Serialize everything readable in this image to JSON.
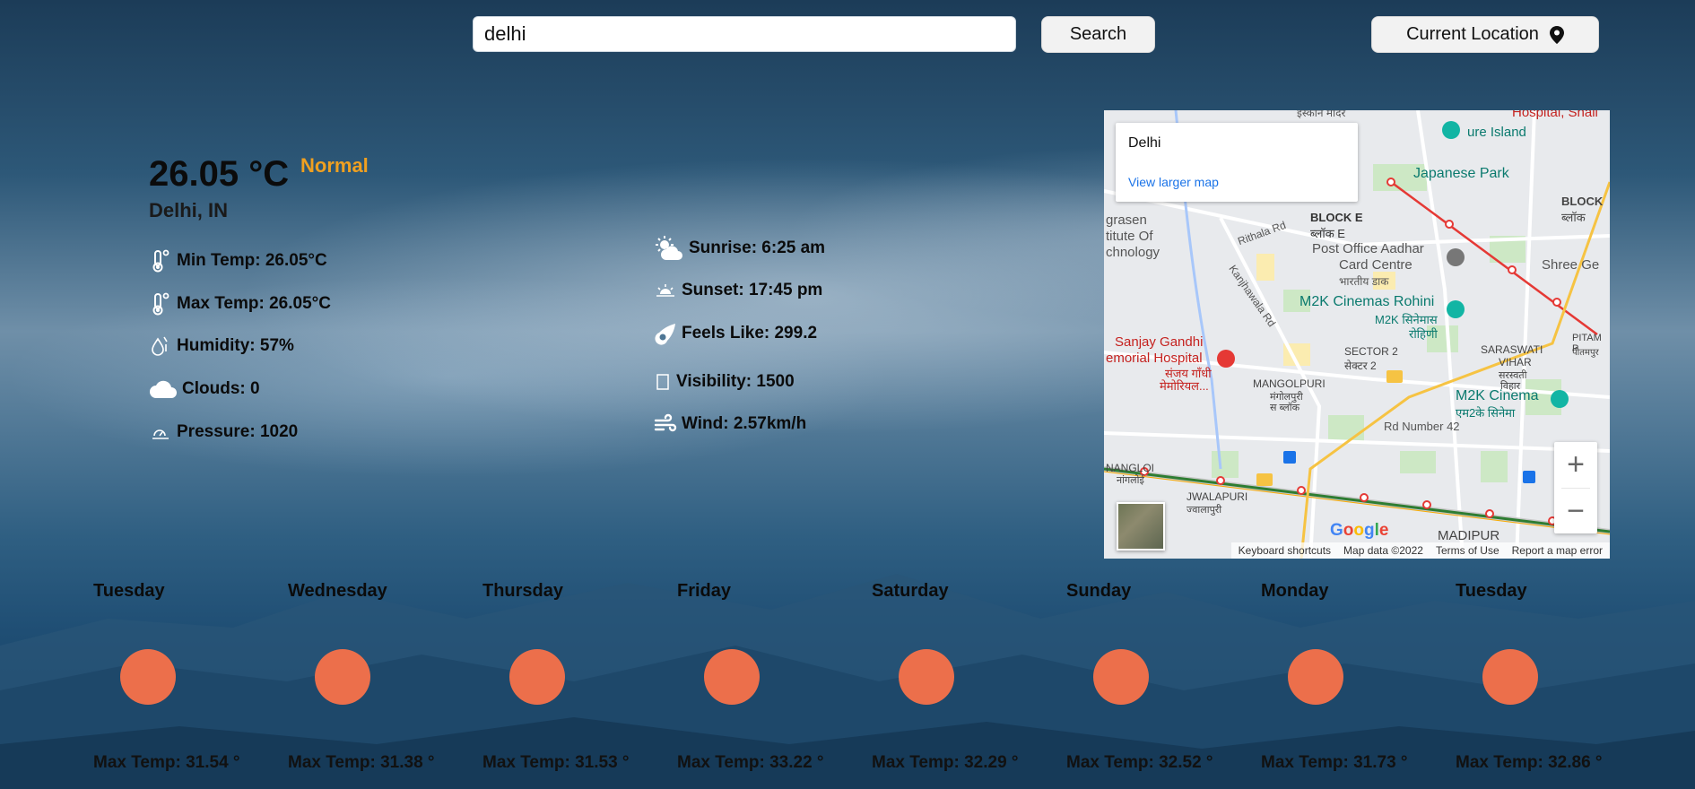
{
  "search": {
    "value": "delhi",
    "button_label": "Search"
  },
  "location_button": {
    "label": "Current Location",
    "icon": "map-pin-icon"
  },
  "current": {
    "temperature": "26.05 °C",
    "status": "Normal",
    "status_color": "#f0a020",
    "city": "Delhi, IN",
    "left_stats": [
      {
        "icon": "thermometer-icon",
        "text": "Min Temp: 26.05°C"
      },
      {
        "icon": "thermometer-icon",
        "text": "Max Temp: 26.05°C"
      },
      {
        "icon": "humidity-icon",
        "text": "Humidity: 57%"
      },
      {
        "icon": "cloud-icon",
        "text": "Clouds: 0"
      },
      {
        "icon": "pressure-icon",
        "text": "Pressure: 1020"
      }
    ],
    "right_stats": [
      {
        "icon": "sunrise-icon",
        "text": "Sunrise: 6:25 am"
      },
      {
        "icon": "sunset-icon",
        "text": "Sunset: 17:45 pm"
      },
      {
        "icon": "feels-like-icon",
        "text": "Feels Like: 299.2"
      },
      {
        "icon": "visibility-icon",
        "text": "Visibility: 1500"
      },
      {
        "icon": "wind-icon",
        "text": "Wind: 2.57km/h"
      }
    ]
  },
  "map": {
    "place_name": "Delhi",
    "larger_map_link": "View larger map",
    "labels": [
      "ure Island",
      "Japanese Park",
      "BLOCK",
      "ब्लॉक",
      "Rithala Rd",
      "BLOCK E",
      "ब्लॉक E",
      "Post Office Aadhar",
      "Card Centre",
      "भारतीय डाक",
      "Shree Ge",
      "grasen",
      "titute Of",
      "chnology",
      "M2K Cinemas Rohini",
      "M2K सिनेमास",
      "रोहिणी",
      "Kanjhawala Rd",
      "Sanjay Gandhi",
      "emorial Hospital",
      "संजय गाँधी",
      "मेमोरियल...",
      "SECTOR 2",
      "सेक्टर 2",
      "MANGOLPURI",
      "मंगोलपुरी",
      "स ब्लॉक",
      "SARASWATI",
      "VIHAR",
      "सरस्वती",
      "विहार",
      "M2K Cinema",
      "एम2के सिनेमा",
      "Rd Number 42",
      "PITAM P",
      "पीतमपुर",
      "NANGLOI",
      "नांगलोई",
      "JWALAPURI",
      "ज्वालापुरी",
      "MADIPUR",
      "Hospital, Shali",
      "इस्कॉन मंदिर"
    ],
    "attribution": {
      "logo": "Google",
      "shortcuts": "Keyboard shortcuts",
      "data": "Map data ©2022",
      "terms": "Terms of Use",
      "report": "Report a map error"
    },
    "zoom_in": "+",
    "zoom_out": "−"
  },
  "forecast": [
    {
      "day": "Tuesday",
      "max": "Max Temp: 31.54 °"
    },
    {
      "day": "Wednesday",
      "max": "Max Temp: 31.38 °"
    },
    {
      "day": "Thursday",
      "max": "Max Temp: 31.53 °"
    },
    {
      "day": "Friday",
      "max": "Max Temp: 33.22 °"
    },
    {
      "day": "Saturday",
      "max": "Max Temp: 32.29 °"
    },
    {
      "day": "Sunday",
      "max": "Max Temp: 32.52 °"
    },
    {
      "day": "Monday",
      "max": "Max Temp: 31.73 °"
    },
    {
      "day": "Tuesday",
      "max": "Max Temp: 32.86 °"
    }
  ],
  "colors": {
    "sun": "#ec6f4b",
    "accent": "#f0a020"
  }
}
